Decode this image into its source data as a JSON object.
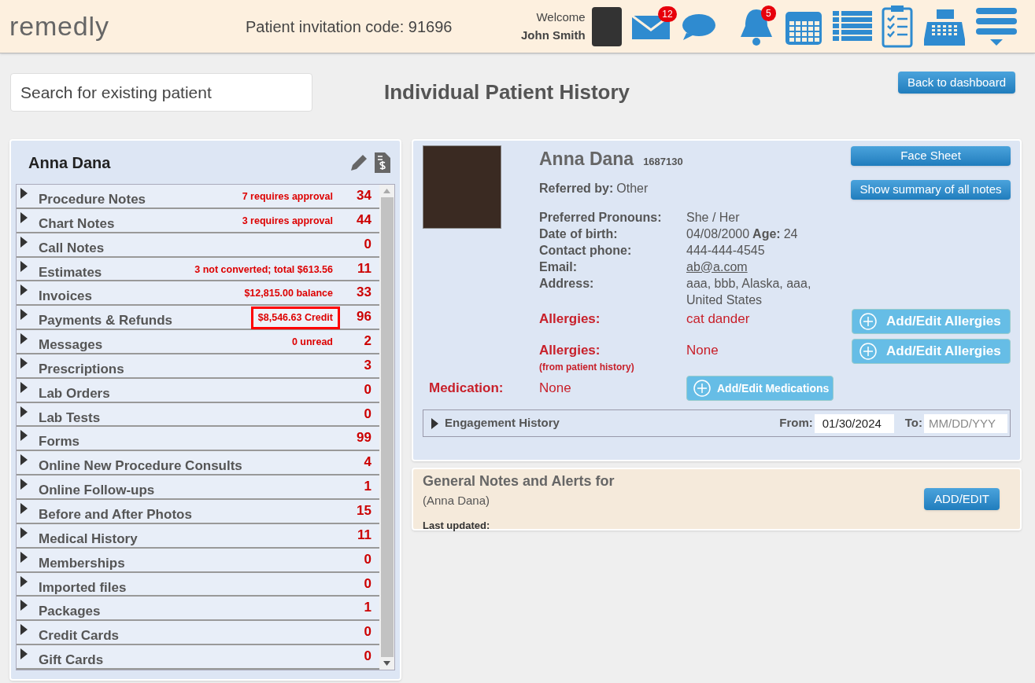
{
  "header": {
    "logo": "remedly",
    "invitation": "Patient invitation code: 91696",
    "welcome": "Welcome",
    "user": "John Smith",
    "mail_badge": "12",
    "bell_badge": "5"
  },
  "search": {
    "placeholder": "Search for existing patient"
  },
  "page_title": "Individual Patient History",
  "back_button": "Back to dashboard",
  "sidebar": {
    "name": "Anna Dana",
    "items": [
      {
        "label": "Procedure Notes",
        "note": {
          "text": "7 requires approval",
          "highlighted": false
        },
        "count": "34"
      },
      {
        "label": "Chart Notes",
        "note": {
          "text": "3 requires approval",
          "highlighted": false
        },
        "count": "44"
      },
      {
        "label": "Call Notes",
        "count": "0"
      },
      {
        "label": "Estimates",
        "note": {
          "text": "3 not converted; total $613.56",
          "highlighted": false
        },
        "count": "11"
      },
      {
        "label": "Invoices",
        "note": {
          "text": "$12,815.00 balance",
          "highlighted": false
        },
        "count": "33"
      },
      {
        "label": "Payments & Refunds",
        "note": {
          "text": "$8,546.63 Credit",
          "highlighted": true
        },
        "count": "96"
      },
      {
        "label": "Messages",
        "note": {
          "text": "0 unread",
          "highlighted": false
        },
        "count": "2"
      },
      {
        "label": "Prescriptions",
        "count": "3"
      },
      {
        "label": "Lab Orders",
        "count": "0"
      },
      {
        "label": "Lab Tests",
        "count": "0"
      },
      {
        "label": "Forms",
        "count": "99"
      },
      {
        "label": "Online New Procedure Consults",
        "count": "4"
      },
      {
        "label": "Online Follow-ups",
        "count": "1"
      },
      {
        "label": "Before and After Photos",
        "count": "15"
      },
      {
        "label": "Medical History",
        "count": "11"
      },
      {
        "label": "Memberships",
        "count": "0"
      },
      {
        "label": "Imported files",
        "count": "0"
      },
      {
        "label": "Packages",
        "count": "1"
      },
      {
        "label": "Credit Cards",
        "count": "0"
      },
      {
        "label": "Gift Cards",
        "count": "0"
      }
    ]
  },
  "patient": {
    "name": "Anna Dana",
    "id": "1687130",
    "referred_label": "Referred by:",
    "referred_value": "Other",
    "fields": [
      {
        "label": "Preferred Pronouns:",
        "value": "She / Her"
      },
      {
        "label": "Date of birth:",
        "value": "04/08/2000",
        "extra_label": "Age:",
        "extra_value": "24"
      },
      {
        "label": "Contact phone:",
        "value": "444-444-4545"
      },
      {
        "label": "Email:",
        "value": "ab@a.com",
        "kind": "link"
      },
      {
        "label": "Address:",
        "value": "aaa, bbb, Alaska, aaa, United States"
      }
    ],
    "allergies": {
      "label": "Allergies:",
      "value": "cat dander",
      "button": "Add/Edit Allergies"
    },
    "history_allergies": {
      "label": "Allergies:",
      "sub": "(from patient history)",
      "value": "None",
      "button": "Add/Edit Allergies"
    },
    "medication": {
      "label": "Medication:",
      "value": "None",
      "button": "Add/Edit Medications"
    },
    "buttons": [
      "Face Sheet",
      "Show summary of all notes"
    ],
    "engagement": {
      "label": "Engagement History",
      "from_label": "From:",
      "from_value": "01/30/2024",
      "to_label": "To:",
      "to_placeholder": "MM/DD/YYY"
    }
  },
  "notes": {
    "title": "General Notes and Alerts for",
    "subtitle": "(Anna Dana)",
    "updated": "Last updated:",
    "button": "ADD/EDIT"
  }
}
